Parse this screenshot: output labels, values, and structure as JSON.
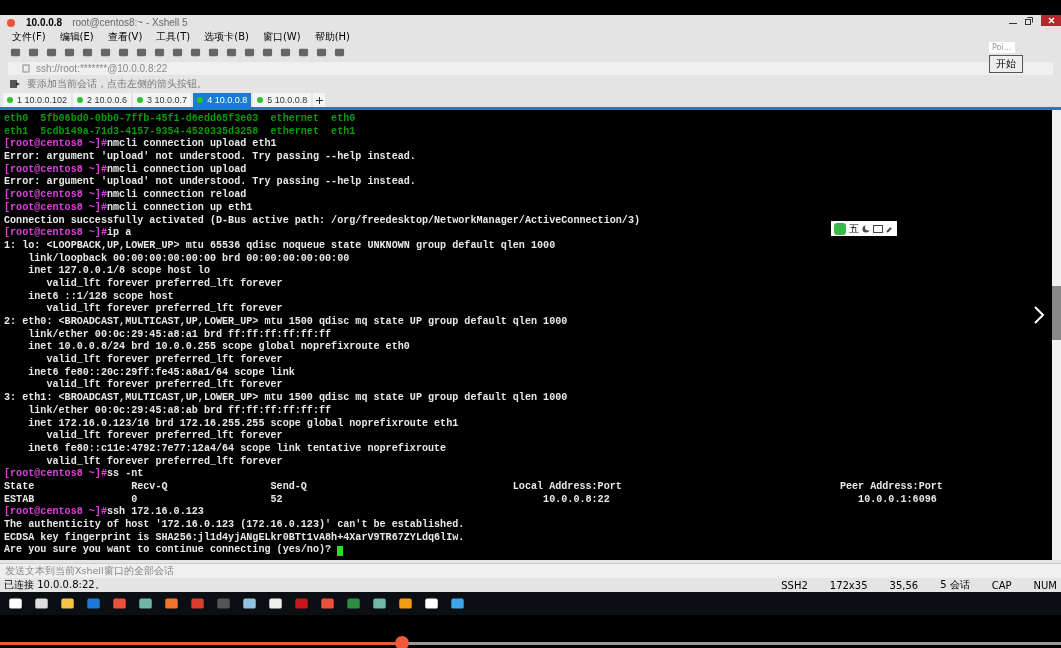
{
  "window": {
    "title_host": "10.0.0.8",
    "title": "root@centos8:~ - Xshell 5"
  },
  "menu": [
    "文件(F)",
    "编辑(E)",
    "查看(V)",
    "工具(T)",
    "选项卡(B)",
    "窗口(W)",
    "帮助(H)"
  ],
  "popup": {
    "text": "Poi...",
    "button": "开始"
  },
  "address": "ssh://root:*******@10.0.0.8:22",
  "hint": "要添加当前会话，点击左侧的箭头按钮。",
  "tabs": [
    {
      "label": "1 10.0.0.102",
      "selected": false
    },
    {
      "label": "2 10.0.0.6",
      "selected": false
    },
    {
      "label": "3 10.0.0.7",
      "selected": false
    },
    {
      "label": "4 10.0.0.8",
      "selected": true
    },
    {
      "label": "5 10.0.0.8",
      "selected": false
    }
  ],
  "terminal": {
    "lines": [
      {
        "kind": "green",
        "text": "eth0  5fb06bd0-0bb0-7ffb-45f1-d6edd65f3e03  ethernet  eth0"
      },
      {
        "kind": "green",
        "text": "eth1  5cdb149a-71d3-4157-9354-4520335d3258  ethernet  eth1"
      },
      {
        "kind": "prompt",
        "prompt": "[root@centos8 ~]#",
        "text": "nmcli connection upload eth1"
      },
      {
        "kind": "output",
        "text": "Error: argument 'upload' not understood. Try passing --help instead."
      },
      {
        "kind": "prompt",
        "prompt": "[root@centos8 ~]#",
        "text": "nmcli connection upload"
      },
      {
        "kind": "output",
        "text": "Error: argument 'upload' not understood. Try passing --help instead."
      },
      {
        "kind": "prompt",
        "prompt": "[root@centos8 ~]#",
        "text": "nmcli connection reload"
      },
      {
        "kind": "prompt",
        "prompt": "[root@centos8 ~]#",
        "text": "nmcli connection up eth1"
      },
      {
        "kind": "output",
        "text": "Connection successfully activated (D-Bus active path: /org/freedesktop/NetworkManager/ActiveConnection/3)"
      },
      {
        "kind": "prompt",
        "prompt": "[root@centos8 ~]#",
        "text": "ip a"
      },
      {
        "kind": "output",
        "text": "1: lo: <LOOPBACK,UP,LOWER_UP> mtu 65536 qdisc noqueue state UNKNOWN group default qlen 1000"
      },
      {
        "kind": "output",
        "text": "    link/loopback 00:00:00:00:00:00 brd 00:00:00:00:00:00"
      },
      {
        "kind": "output",
        "text": "    inet 127.0.0.1/8 scope host lo"
      },
      {
        "kind": "output",
        "text": "       valid_lft forever preferred_lft forever"
      },
      {
        "kind": "output",
        "text": "    inet6 ::1/128 scope host"
      },
      {
        "kind": "output",
        "text": "       valid_lft forever preferred_lft forever"
      },
      {
        "kind": "output",
        "text": "2: eth0: <BROADCAST,MULTICAST,UP,LOWER_UP> mtu 1500 qdisc mq state UP group default qlen 1000"
      },
      {
        "kind": "output",
        "text": "    link/ether 00:0c:29:45:a8:a1 brd ff:ff:ff:ff:ff:ff"
      },
      {
        "kind": "output",
        "text": "    inet 10.0.0.8/24 brd 10.0.0.255 scope global noprefixroute eth0"
      },
      {
        "kind": "output",
        "text": "       valid_lft forever preferred_lft forever"
      },
      {
        "kind": "output",
        "text": "    inet6 fe80::20c:29ff:fe45:a8a1/64 scope link"
      },
      {
        "kind": "output",
        "text": "       valid_lft forever preferred_lft forever"
      },
      {
        "kind": "output",
        "text": "3: eth1: <BROADCAST,MULTICAST,UP,LOWER_UP> mtu 1500 qdisc mq state UP group default qlen 1000"
      },
      {
        "kind": "output",
        "text": "    link/ether 00:0c:29:45:a8:ab brd ff:ff:ff:ff:ff:ff"
      },
      {
        "kind": "output",
        "text": "    inet 172.16.0.123/16 brd 172.16.255.255 scope global noprefixroute eth1"
      },
      {
        "kind": "output",
        "text": "       valid_lft forever preferred_lft forever"
      },
      {
        "kind": "output",
        "text": "    inet6 fe80::c11e:4792:7e77:12a4/64 scope link tentative noprefixroute"
      },
      {
        "kind": "output",
        "text": "       valid_lft forever preferred_lft forever"
      },
      {
        "kind": "prompt",
        "prompt": "[root@centos8 ~]#",
        "text": "ss -nt"
      },
      {
        "kind": "output",
        "text": "State                Recv-Q                 Send-Q                                  Local Address:Port                                    Peer Address:Port"
      },
      {
        "kind": "output",
        "text": "ESTAB                0                      52                                           10.0.0.8:22                                         10.0.0.1:6096"
      },
      {
        "kind": "prompt",
        "prompt": "[root@centos8 ~]#",
        "text": "ssh 172.16.0.123"
      },
      {
        "kind": "output",
        "text": "The authenticity of host '172.16.0.123 (172.16.0.123)' can't be established."
      },
      {
        "kind": "output",
        "text": "ECDSA key fingerprint is SHA256:jl1d4yjANgELkr0BTt1vA8h+4XarV9TR67ZYLdq6lIw."
      },
      {
        "kind": "output",
        "text": "Are you sure you want to continue connecting (yes/no)? ",
        "cursor": true
      }
    ]
  },
  "ime_toolbar": {
    "mode": "五"
  },
  "send_bar": {
    "placeholder": "发送文本到当前Xshell窗口的全部会话"
  },
  "status_bar": {
    "left": "已连接 10.0.0.8:22。",
    "items": [
      "SSH2",
      "172x35",
      "35,56",
      "5 会话",
      "CAP",
      "NUM"
    ]
  },
  "video": {
    "level": 0.379
  }
}
